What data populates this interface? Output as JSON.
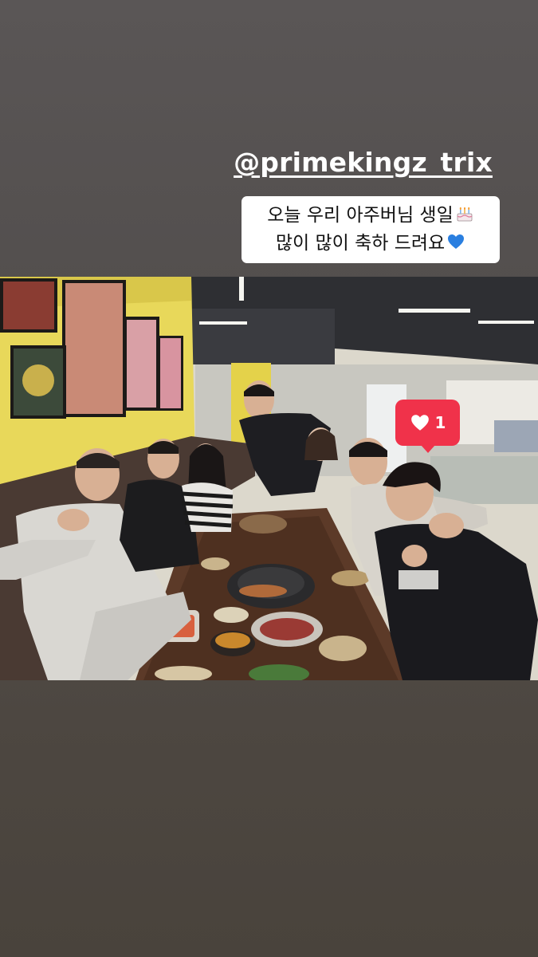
{
  "story": {
    "mention": "@primekingz_trix",
    "caption": {
      "line1": "오늘 우리 아주버님 생일",
      "line1_emoji": "birthday-cake-icon",
      "line2": "많이 많이 축하 드려요",
      "line2_emoji": "blue-heart-icon"
    },
    "like_sticker": {
      "icon": "heart-icon",
      "count": "1"
    }
  },
  "colors": {
    "background": "#534f4e",
    "like_sticker": "#f0324a",
    "blue_heart": "#2a7fe0",
    "wall_yellow": "#e8d85a"
  }
}
